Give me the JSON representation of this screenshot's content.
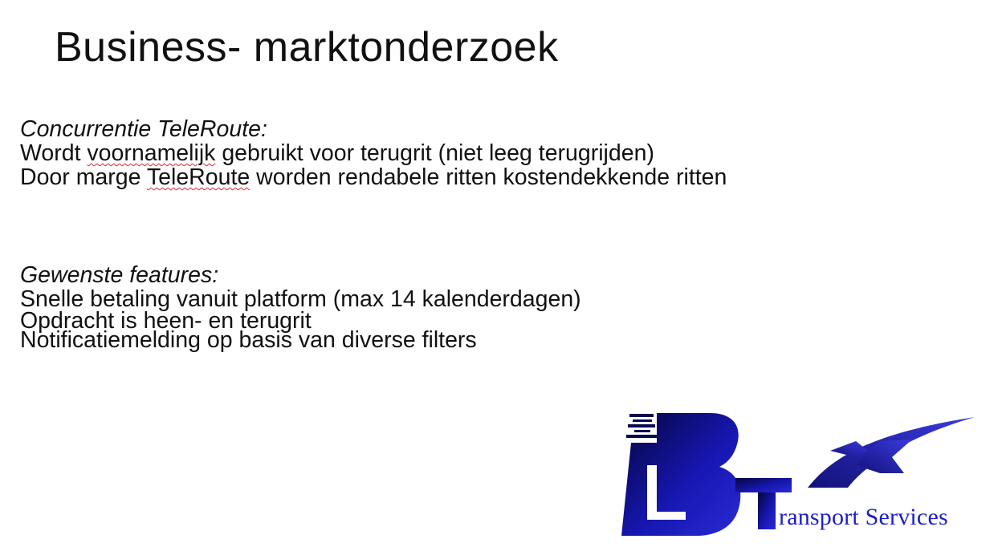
{
  "slide": {
    "title": "Business- marktonderzoek"
  },
  "concurrentie": {
    "heading": "Concurrentie TeleRoute:",
    "line1_pre": "Wordt ",
    "line1_spell": "voornamelijk",
    "line1_post": " gebruikt voor terugrit (niet leeg terugrijden)",
    "line2_pre": "Door marge ",
    "line2_spell": "TeleRoute",
    "line2_post": " worden rendabele ritten kostendekkende ritten"
  },
  "features": {
    "heading": "Gewenste features:",
    "items": [
      "Snelle betaling vanuit platform (max 14 kalenderdagen)",
      "Opdracht is heen- en terugrit",
      "Notificatiemelding op basis van diverse filters"
    ]
  },
  "logo": {
    "text": "ransport Services",
    "colors": {
      "primary": "#1a1fc8",
      "dark": "#0a0a60"
    }
  }
}
